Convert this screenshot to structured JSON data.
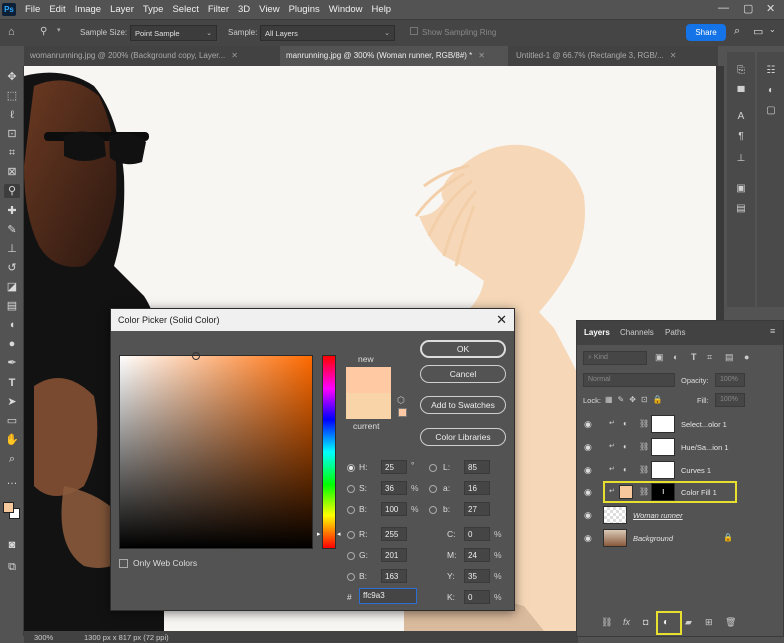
{
  "menubar": {
    "logo": "Ps",
    "items": [
      "File",
      "Edit",
      "Image",
      "Layer",
      "Type",
      "Select",
      "Filter",
      "3D",
      "View",
      "Plugins",
      "Window",
      "Help"
    ]
  },
  "options": {
    "sample_size_label": "Sample Size:",
    "sample_size_value": "Point Sample",
    "sample_label": "Sample:",
    "sample_value": "All Layers",
    "show_ring": "Show Sampling Ring",
    "share": "Share"
  },
  "tabs": [
    {
      "label": "womanrunning.jpg @ 200% (Background copy, Layer..."
    },
    {
      "label": "manrunning.jpg @ 300% (Woman runner, RGB/8#) *"
    },
    {
      "label": "Untitled-1 @ 66.7% (Rectangle 3, RGB/..."
    }
  ],
  "status": {
    "zoom": "300%",
    "doc": "1300 px x 817 px (72 ppi)"
  },
  "dialog": {
    "title": "Color Picker (Solid Color)",
    "new_label": "new",
    "current_label": "current",
    "new_color": "#ffc9a3",
    "current_color": "#f8d4a8",
    "ok": "OK",
    "cancel": "Cancel",
    "add_swatches": "Add to Swatches",
    "color_libraries": "Color Libraries",
    "only_web": "Only Web Colors",
    "hsb": [
      {
        "label": "H:",
        "value": "25",
        "unit": "°"
      },
      {
        "label": "S:",
        "value": "36",
        "unit": "%"
      },
      {
        "label": "B:",
        "value": "100",
        "unit": "%"
      }
    ],
    "rgb": [
      {
        "label": "R:",
        "value": "255"
      },
      {
        "label": "G:",
        "value": "201"
      },
      {
        "label": "B:",
        "value": "163"
      }
    ],
    "lab": [
      {
        "label": "L:",
        "value": "85"
      },
      {
        "label": "a:",
        "value": "16"
      },
      {
        "label": "b:",
        "value": "27"
      }
    ],
    "cmyk": [
      {
        "label": "C:",
        "value": "0",
        "unit": "%"
      },
      {
        "label": "M:",
        "value": "24",
        "unit": "%"
      },
      {
        "label": "Y:",
        "value": "35",
        "unit": "%"
      },
      {
        "label": "K:",
        "value": "0",
        "unit": "%"
      }
    ],
    "hex_label": "#",
    "hex": "ffc9a3"
  },
  "layers": {
    "tabs": [
      "Layers",
      "Channels",
      "Paths"
    ],
    "kind": "Kind",
    "blend": "Normal",
    "opacity_label": "Opacity:",
    "opacity": "100%",
    "lock_label": "Lock:",
    "fill_label": "Fill:",
    "fill": "100%",
    "items": [
      {
        "name": "Select...olor 1"
      },
      {
        "name": "Hue/Sa...ion 1"
      },
      {
        "name": "Curves 1"
      },
      {
        "name": "Color Fill 1"
      },
      {
        "name": "Woman runner"
      },
      {
        "name": "Background"
      }
    ]
  },
  "colors": {
    "accent": "#1473e6",
    "highlight": "#e8e030",
    "fill_swatch": "#f6c89c"
  }
}
